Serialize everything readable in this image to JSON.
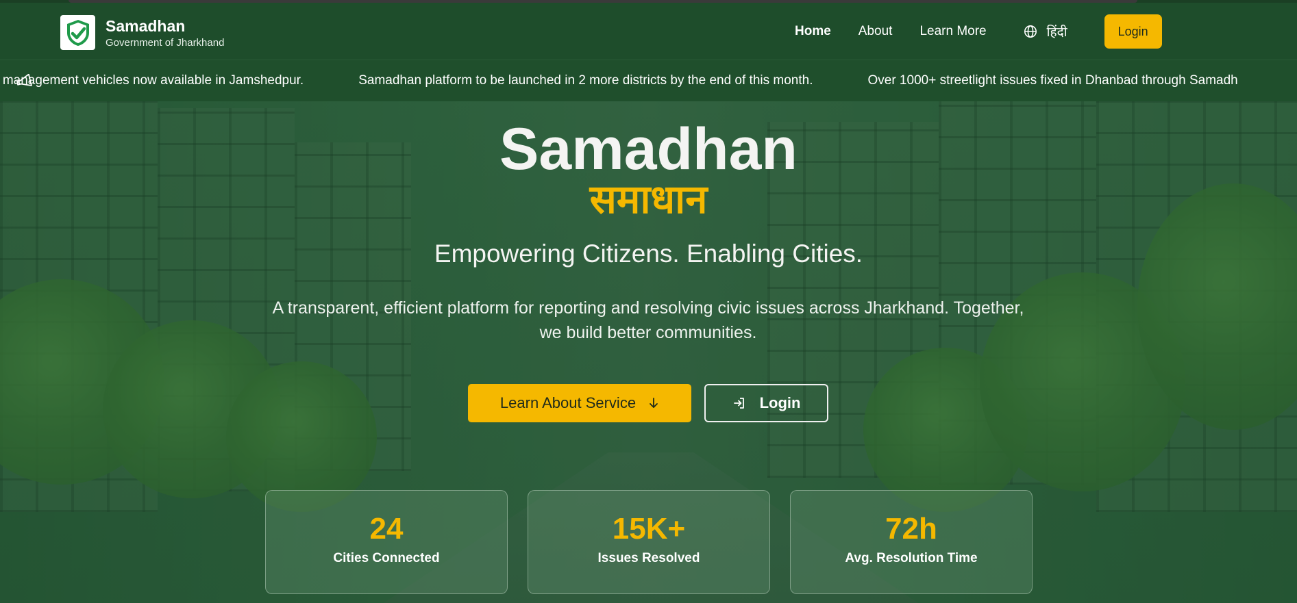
{
  "colors": {
    "primary_green": "#1e4d2b",
    "accent_yellow": "#f5b800",
    "text_white": "#ffffff"
  },
  "navbar": {
    "brand_name": "Samadhan",
    "brand_sub": "Government of Jharkhand",
    "logo_icon": "check-shield-icon",
    "links": [
      {
        "label": "Home",
        "active": true
      },
      {
        "label": "About",
        "active": false
      },
      {
        "label": "Learn More",
        "active": false
      }
    ],
    "lang_icon": "globe-icon",
    "lang_label": "हिंदी",
    "login_label": "Login"
  },
  "ticker": {
    "icon": "megaphone-icon",
    "items": [
      "e management vehicles now available in Jamshedpur.",
      "Samadhan platform to be launched in 2 more districts by the end of this month.",
      "Over 1000+ streetlight issues fixed in Dhanbad through Samadh"
    ]
  },
  "hero": {
    "title": "Samadhan",
    "title_hindi": "समाधान",
    "tagline": "Empowering Citizens. Enabling Cities.",
    "description": "A transparent, efficient platform for reporting and resolving civic issues across Jharkhand. Together, we build better communities.",
    "primary_button": "Learn About Service",
    "primary_button_icon": "arrow-down-icon",
    "secondary_button": "Login",
    "secondary_button_icon": "login-icon"
  },
  "stats": [
    {
      "value": "24",
      "label": "Cities Connected"
    },
    {
      "value": "15K+",
      "label": "Issues Resolved"
    },
    {
      "value": "72h",
      "label": "Avg. Resolution Time"
    }
  ]
}
